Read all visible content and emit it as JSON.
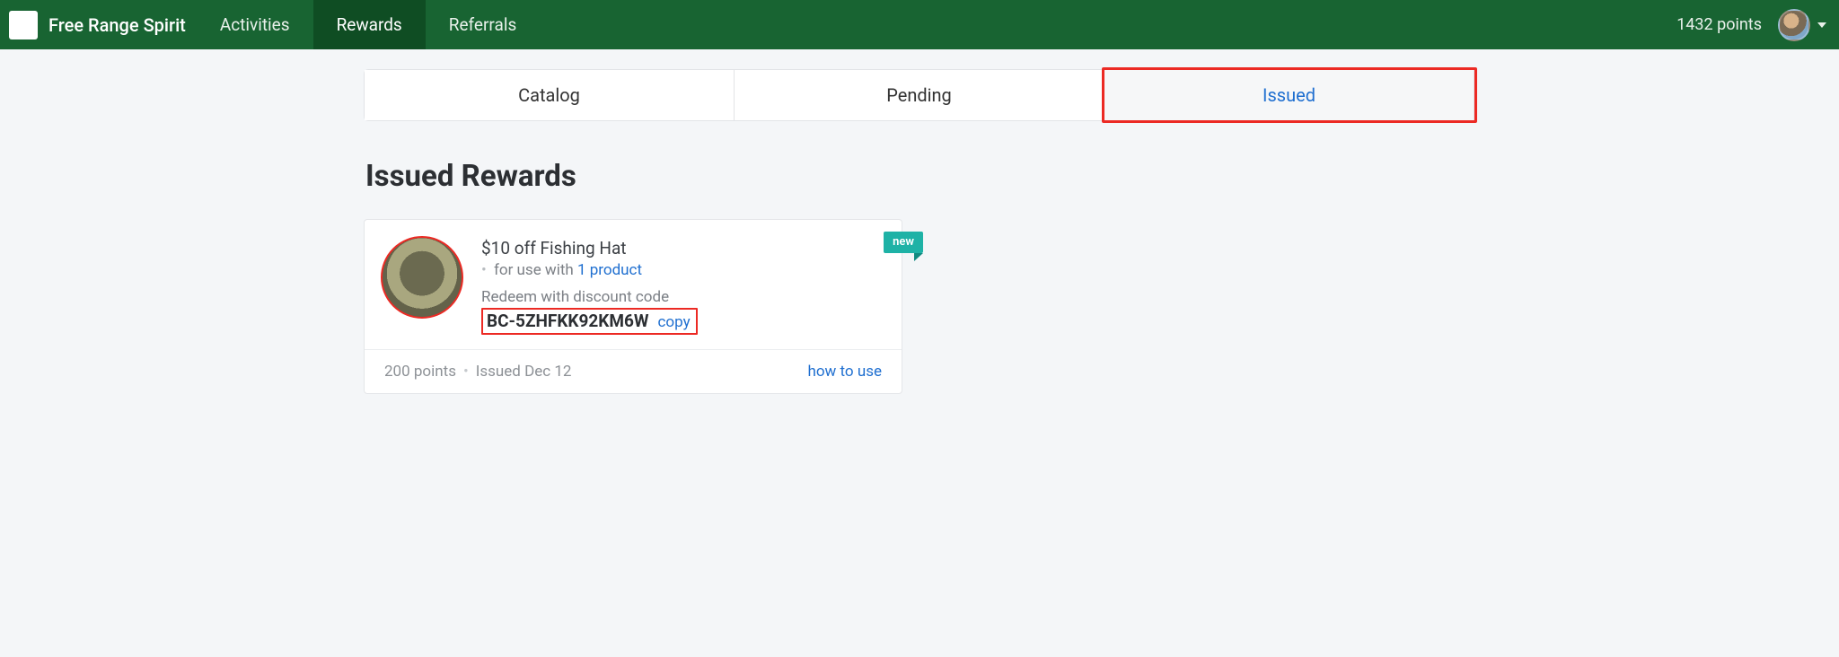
{
  "nav": {
    "brand": "Free Range Spirit",
    "items": [
      {
        "label": "Activities",
        "active": false
      },
      {
        "label": "Rewards",
        "active": true
      },
      {
        "label": "Referrals",
        "active": false
      }
    ],
    "points": "1432 points"
  },
  "tabs": {
    "items": [
      {
        "label": "Catalog",
        "active": false
      },
      {
        "label": "Pending",
        "active": false
      },
      {
        "label": "Issued",
        "active": true
      }
    ]
  },
  "page": {
    "heading": "Issued Rewards"
  },
  "reward": {
    "badge": "new",
    "title": "$10 off Fishing Hat",
    "use_prefix": "for use with",
    "use_link": "1 product",
    "redeem_label": "Redeem with discount code",
    "code": "BC-5ZHFKK92KM6W",
    "copy_label": "copy",
    "points": "200 points",
    "issued": "Issued Dec 12",
    "howto": "how to use"
  }
}
